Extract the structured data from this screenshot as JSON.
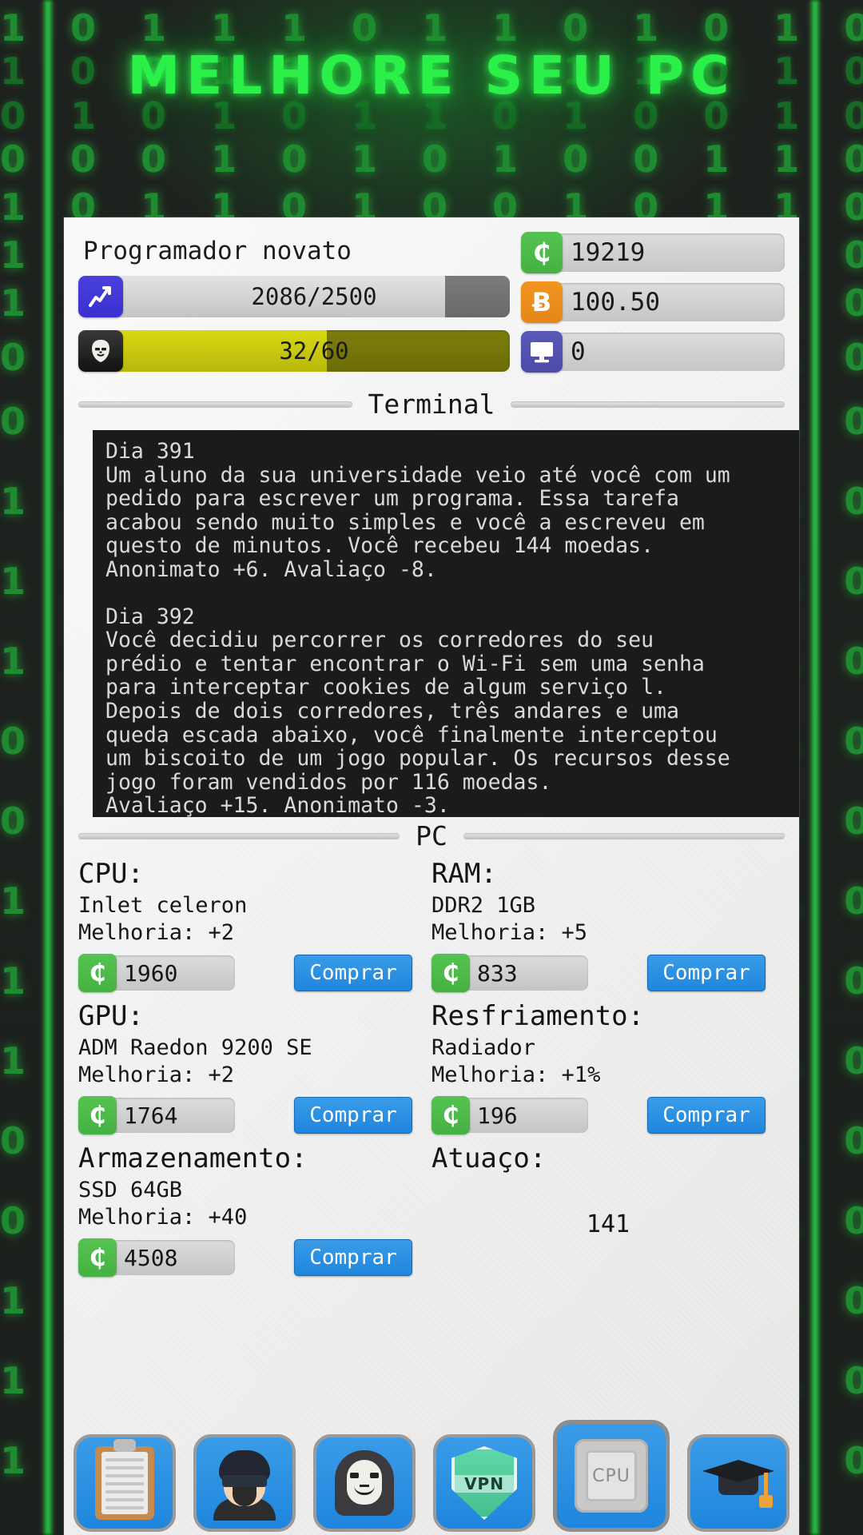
{
  "app": {
    "title": "MELHORE SEU PC",
    "background_binary_rows": [
      "1 0 1 1 1 0 1 1 0 1 0 1 0 0 1 0 1 1 0 1 0 1 0 0 1 0 1 0 1 1 0",
      "1 0 0 1 1 0 1 0 1 1 0 1 0 0 1 0 1 1 1 0 1",
      "0 1 0 1 0 1 1 0 1 0 0 1 0 1 1 0 1 0 1 0 1 0",
      "0 0 0 1 0 1 0 1 0 0 1 1 0 1 0 1 1 0 0 1 0 1 0 1 0 1 1 1 0",
      "1 0 1 1 0 1 0 0 1 0 1 1 0 1 0 0 1 0 1 0 1 0 1 1 0 1 0",
      "1 0 0 1 0 1 1 0 1 0 0 1 0 1 1 0 1 0 0 1 0 1 0 1 1 0 1 0"
    ]
  },
  "player": {
    "rank": "Programador novato",
    "experience": {
      "icon": "chart-up-icon",
      "label": "2086/2500",
      "current": 2086,
      "max": 2500,
      "percent": 83.4
    },
    "anonymity": {
      "icon": "anonymous-mask-icon",
      "label": "32/60",
      "current": 32,
      "max": 60,
      "percent": 53.3
    }
  },
  "currencies": [
    {
      "icon": "cedi-coin-icon",
      "glyph": "₵",
      "color": "#4ab747",
      "value": "19219"
    },
    {
      "icon": "bitcoin-icon",
      "glyph": "Ƀ",
      "color": "#ef8f1e",
      "value": "100.50"
    },
    {
      "icon": "monitor-icon",
      "glyph": "",
      "color": "#5754b4",
      "value": "0"
    }
  ],
  "terminal": {
    "section_label": "Terminal",
    "entries": [
      {
        "day": "Dia 391",
        "text": "Um aluno da sua universidade veio até você com um\npedido para escrever um programa. Essa tarefa\nacabou sendo muito simples e você a escreveu em\nquesto de minutos. Você recebeu 144 moedas.\nAnonimato +6. Avaliaço -8."
      },
      {
        "day": "Dia 392",
        "text": "Você decidiu percorrer os corredores do seu\nprédio e tentar encontrar o Wi-Fi sem uma senha\npara interceptar cookies de algum serviço l.\nDepois de dois corredores, três andares e uma\nqueda escada abaixo, você finalmente interceptou\num biscoito de um jogo popular. Os recursos desse\njogo foram vendidos por 116 moedas.\nAvaliaço +15. Anonimato -3."
      }
    ]
  },
  "pc": {
    "section_label": "PC",
    "buy_label": "Comprar",
    "components": [
      {
        "name": "CPU:",
        "model": "Inlet celeron",
        "upgrade": "Melhoria: +2",
        "price": "1960"
      },
      {
        "name": "RAM:",
        "model": "DDR2 1GB",
        "upgrade": "Melhoria: +5",
        "price": "833"
      },
      {
        "name": "GPU:",
        "model": "ADM Raedon 9200 SE",
        "upgrade": "Melhoria: +2",
        "price": "1764"
      },
      {
        "name": "Resfriamento:",
        "model": "Radiador",
        "upgrade": "Melhoria: +1%",
        "price": "196"
      },
      {
        "name": "Armazenamento:",
        "model": "SSD 64GB",
        "upgrade": "Melhoria: +40",
        "price": "4508"
      }
    ],
    "performance": {
      "name": "Atuaço:",
      "value": "141"
    }
  },
  "nav": [
    {
      "icon": "clipboard-icon",
      "name": "tasks"
    },
    {
      "icon": "person-icon",
      "name": "profile"
    },
    {
      "icon": "anonymous-icon",
      "name": "darknet"
    },
    {
      "icon": "vpn-shield-icon",
      "name": "vpn"
    },
    {
      "icon": "cpu-chip-icon",
      "name": "pc",
      "selected": true
    },
    {
      "icon": "graduation-cap-icon",
      "name": "education"
    }
  ]
}
